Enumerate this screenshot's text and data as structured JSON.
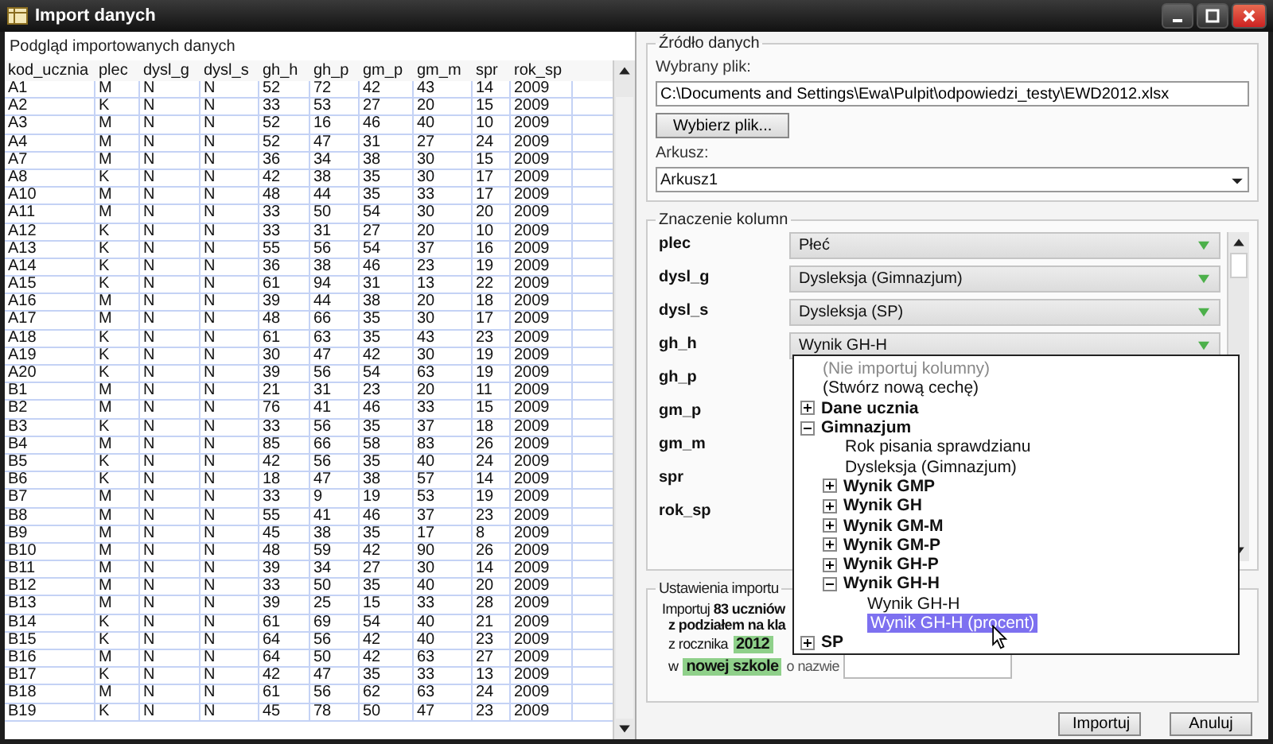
{
  "window": {
    "title": "Import danych"
  },
  "preview": {
    "title": "Podgląd importowanych danych",
    "columns": [
      "kod_ucznia",
      "plec",
      "dysl_g",
      "dysl_s",
      "gh_h",
      "gh_p",
      "gm_p",
      "gm_m",
      "spr",
      "rok_sp"
    ],
    "rows": [
      [
        "A1",
        "M",
        "N",
        "N",
        "52",
        "72",
        "42",
        "43",
        "14",
        "2009"
      ],
      [
        "A2",
        "K",
        "N",
        "N",
        "33",
        "53",
        "27",
        "20",
        "15",
        "2009"
      ],
      [
        "A3",
        "M",
        "N",
        "N",
        "52",
        "16",
        "46",
        "40",
        "10",
        "2009"
      ],
      [
        "A4",
        "M",
        "N",
        "N",
        "52",
        "47",
        "31",
        "27",
        "24",
        "2009"
      ],
      [
        "A7",
        "M",
        "N",
        "N",
        "36",
        "34",
        "38",
        "30",
        "15",
        "2009"
      ],
      [
        "A8",
        "K",
        "N",
        "N",
        "42",
        "38",
        "35",
        "30",
        "17",
        "2009"
      ],
      [
        "A10",
        "M",
        "N",
        "N",
        "48",
        "44",
        "35",
        "33",
        "17",
        "2009"
      ],
      [
        "A11",
        "M",
        "N",
        "N",
        "33",
        "50",
        "54",
        "30",
        "20",
        "2009"
      ],
      [
        "A12",
        "K",
        "N",
        "N",
        "33",
        "31",
        "27",
        "20",
        "10",
        "2009"
      ],
      [
        "A13",
        "K",
        "N",
        "N",
        "55",
        "56",
        "54",
        "37",
        "16",
        "2009"
      ],
      [
        "A14",
        "K",
        "N",
        "N",
        "36",
        "38",
        "46",
        "23",
        "19",
        "2009"
      ],
      [
        "A15",
        "K",
        "N",
        "N",
        "61",
        "94",
        "31",
        "13",
        "22",
        "2009"
      ],
      [
        "A16",
        "M",
        "N",
        "N",
        "39",
        "44",
        "38",
        "20",
        "18",
        "2009"
      ],
      [
        "A17",
        "M",
        "N",
        "N",
        "48",
        "66",
        "35",
        "30",
        "17",
        "2009"
      ],
      [
        "A18",
        "K",
        "N",
        "N",
        "61",
        "63",
        "35",
        "43",
        "23",
        "2009"
      ],
      [
        "A19",
        "K",
        "N",
        "N",
        "30",
        "47",
        "42",
        "30",
        "19",
        "2009"
      ],
      [
        "A20",
        "K",
        "N",
        "N",
        "39",
        "56",
        "54",
        "63",
        "19",
        "2009"
      ],
      [
        "B1",
        "M",
        "N",
        "N",
        "21",
        "31",
        "23",
        "20",
        "11",
        "2009"
      ],
      [
        "B2",
        "M",
        "N",
        "N",
        "76",
        "41",
        "46",
        "33",
        "15",
        "2009"
      ],
      [
        "B3",
        "K",
        "N",
        "N",
        "33",
        "56",
        "35",
        "37",
        "18",
        "2009"
      ],
      [
        "B4",
        "M",
        "N",
        "N",
        "85",
        "66",
        "58",
        "83",
        "26",
        "2009"
      ],
      [
        "B5",
        "K",
        "N",
        "N",
        "42",
        "56",
        "35",
        "40",
        "24",
        "2009"
      ],
      [
        "B6",
        "K",
        "N",
        "N",
        "18",
        "47",
        "38",
        "57",
        "14",
        "2009"
      ],
      [
        "B7",
        "M",
        "N",
        "N",
        "33",
        "9",
        "19",
        "53",
        "19",
        "2009"
      ],
      [
        "B8",
        "M",
        "N",
        "N",
        "55",
        "41",
        "46",
        "37",
        "23",
        "2009"
      ],
      [
        "B9",
        "M",
        "N",
        "N",
        "45",
        "38",
        "35",
        "17",
        "8",
        "2009"
      ],
      [
        "B10",
        "M",
        "N",
        "N",
        "48",
        "59",
        "42",
        "90",
        "26",
        "2009"
      ],
      [
        "B11",
        "M",
        "N",
        "N",
        "39",
        "34",
        "27",
        "30",
        "14",
        "2009"
      ],
      [
        "B12",
        "M",
        "N",
        "N",
        "33",
        "50",
        "35",
        "40",
        "20",
        "2009"
      ],
      [
        "B13",
        "M",
        "N",
        "N",
        "39",
        "25",
        "15",
        "33",
        "28",
        "2009"
      ],
      [
        "B14",
        "K",
        "N",
        "N",
        "61",
        "69",
        "54",
        "40",
        "21",
        "2009"
      ],
      [
        "B15",
        "K",
        "N",
        "N",
        "64",
        "56",
        "42",
        "40",
        "23",
        "2009"
      ],
      [
        "B16",
        "M",
        "N",
        "N",
        "64",
        "50",
        "42",
        "63",
        "27",
        "2009"
      ],
      [
        "B17",
        "K",
        "N",
        "N",
        "42",
        "47",
        "35",
        "33",
        "13",
        "2009"
      ],
      [
        "B18",
        "M",
        "N",
        "N",
        "61",
        "56",
        "62",
        "63",
        "24",
        "2009"
      ],
      [
        "B19",
        "K",
        "N",
        "N",
        "45",
        "78",
        "50",
        "47",
        "23",
        "2009"
      ]
    ]
  },
  "source": {
    "title": "Źródło danych",
    "file_label": "Wybrany plik:",
    "file_value": "C:\\Documents and Settings\\Ewa\\Pulpit\\odpowiedzi_testy\\EWD2012.xlsx",
    "choose_button": "Wybierz plik...",
    "sheet_label": "Arkusz:",
    "sheet_value": "Arkusz1"
  },
  "mapping": {
    "title": "Znaczenie kolumn",
    "rows": [
      {
        "column": "plec",
        "value": "Płeć"
      },
      {
        "column": "dysl_g",
        "value": "Dysleksja (Gimnazjum)"
      },
      {
        "column": "dysl_s",
        "value": "Dysleksja (SP)"
      },
      {
        "column": "gh_h",
        "value": "Wynik GH-H"
      },
      {
        "column": "gh_p"
      },
      {
        "column": "gm_p"
      },
      {
        "column": "gm_m"
      },
      {
        "column": "spr"
      },
      {
        "column": "rok_sp"
      }
    ],
    "dropdown": [
      {
        "label": "(Nie importuj kolumny)",
        "kind": "option",
        "disabled": true,
        "selected": false
      },
      {
        "label": "(Stwórz nową cechę)",
        "kind": "option",
        "disabled": false,
        "selected": false
      },
      {
        "label": "Dane ucznia",
        "kind": "group",
        "expanded": false
      },
      {
        "label": "Gimnazjum",
        "kind": "group",
        "expanded": true,
        "children": [
          {
            "label": "Rok pisania sprawdzianu",
            "kind": "option",
            "disabled": false,
            "selected": false
          },
          {
            "label": "Dysleksja (Gimnazjum)",
            "kind": "option",
            "disabled": false,
            "selected": false
          },
          {
            "label": "Wynik GMP",
            "kind": "group",
            "expanded": false
          },
          {
            "label": "Wynik GH",
            "kind": "group",
            "expanded": false
          },
          {
            "label": "Wynik GM-M",
            "kind": "group",
            "expanded": false
          },
          {
            "label": "Wynik GM-P",
            "kind": "group",
            "expanded": false
          },
          {
            "label": "Wynik GH-P",
            "kind": "group",
            "expanded": false
          },
          {
            "label": "Wynik GH-H",
            "kind": "group",
            "expanded": true,
            "children": [
              {
                "label": "Wynik GH-H",
                "kind": "option",
                "disabled": false,
                "selected": false
              },
              {
                "label": "Wynik GH-H (procent)",
                "kind": "option",
                "disabled": false,
                "selected": true
              }
            ]
          }
        ]
      },
      {
        "label": "SP",
        "kind": "group",
        "expanded": false
      }
    ]
  },
  "settings": {
    "title": "Ustawienia importu",
    "import_text": "Importuj **83 uczniów**",
    "split_text": "z podziałem na kla",
    "year_label": "z rocznika",
    "year_value": "2012",
    "school_label": "w",
    "school_value": "nowej szkole",
    "name_label": "o nazwie"
  },
  "buttons": [
    "Importuj",
    "Anuluj"
  ]
}
